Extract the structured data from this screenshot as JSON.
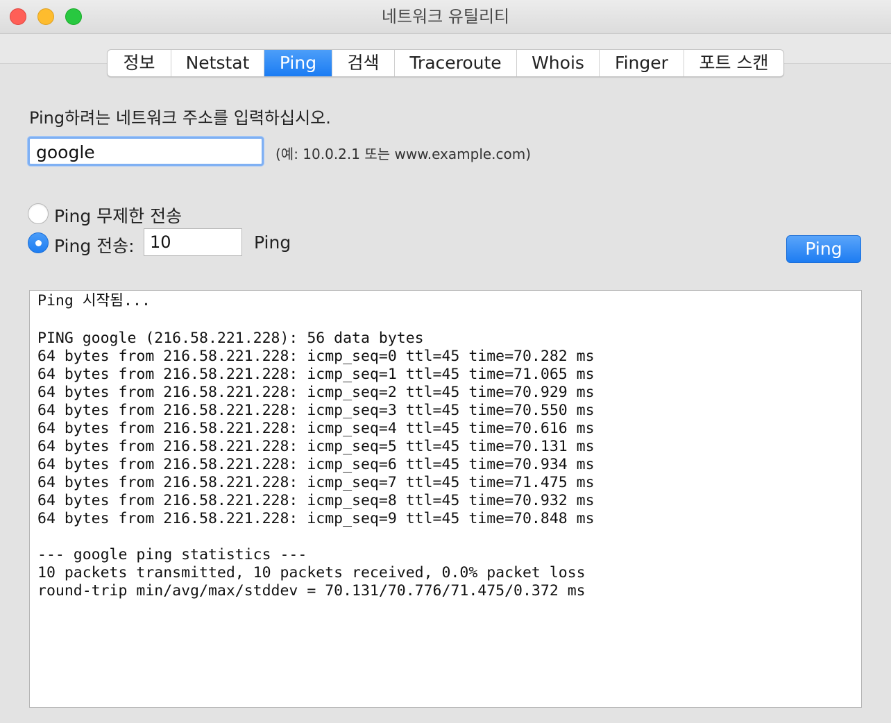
{
  "window": {
    "title": "네트워크 유틸리티"
  },
  "tabs": [
    {
      "label": "정보",
      "active": false
    },
    {
      "label": "Netstat",
      "active": false
    },
    {
      "label": "Ping",
      "active": true
    },
    {
      "label": "검색",
      "active": false
    },
    {
      "label": "Traceroute",
      "active": false
    },
    {
      "label": "Whois",
      "active": false
    },
    {
      "label": "Finger",
      "active": false
    },
    {
      "label": "포트 스캔",
      "active": false
    }
  ],
  "ping": {
    "instruction": "Ping하려는 네트워크 주소를 입력하십시오.",
    "address_value": "google",
    "example_hint": "(예: 10.0.2.1 또는 www.example.com)",
    "unlimited_label": "Ping 무제한 전송",
    "send_label": "Ping 전송:",
    "count_value": "10",
    "count_suffix": "Ping",
    "button_label": "Ping",
    "selected_option": "send"
  },
  "output": [
    "Ping 시작됨...",
    "",
    "PING google (216.58.221.228): 56 data bytes",
    "64 bytes from 216.58.221.228: icmp_seq=0 ttl=45 time=70.282 ms",
    "64 bytes from 216.58.221.228: icmp_seq=1 ttl=45 time=71.065 ms",
    "64 bytes from 216.58.221.228: icmp_seq=2 ttl=45 time=70.929 ms",
    "64 bytes from 216.58.221.228: icmp_seq=3 ttl=45 time=70.550 ms",
    "64 bytes from 216.58.221.228: icmp_seq=4 ttl=45 time=70.616 ms",
    "64 bytes from 216.58.221.228: icmp_seq=5 ttl=45 time=70.131 ms",
    "64 bytes from 216.58.221.228: icmp_seq=6 ttl=45 time=70.934 ms",
    "64 bytes from 216.58.221.228: icmp_seq=7 ttl=45 time=71.475 ms",
    "64 bytes from 216.58.221.228: icmp_seq=8 ttl=45 time=70.932 ms",
    "64 bytes from 216.58.221.228: icmp_seq=9 ttl=45 time=70.848 ms",
    "",
    "--- google ping statistics ---",
    "10 packets transmitted, 10 packets received, 0.0% packet loss",
    "round-trip min/avg/max/stddev = 70.131/70.776/71.475/0.372 ms"
  ],
  "colors": {
    "accent": "#1d7cf2",
    "close": "#ff5f57",
    "minimize": "#febc2e",
    "maximize": "#28c840"
  }
}
